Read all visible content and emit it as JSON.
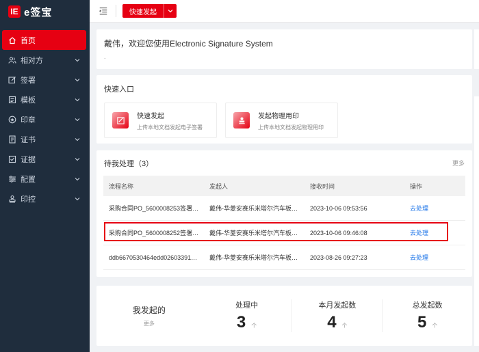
{
  "logo": {
    "mark": "IE",
    "text": "e签宝"
  },
  "sidebar": {
    "items": [
      {
        "label": "首页",
        "icon": "home-icon",
        "active": true
      },
      {
        "label": "相对方",
        "icon": "users-icon"
      },
      {
        "label": "签署",
        "icon": "edit-icon"
      },
      {
        "label": "模板",
        "icon": "template-icon"
      },
      {
        "label": "印章",
        "icon": "seal-icon"
      },
      {
        "label": "证书",
        "icon": "certificate-icon"
      },
      {
        "label": "证据",
        "icon": "evidence-icon"
      },
      {
        "label": "配置",
        "icon": "settings-icon"
      },
      {
        "label": "印控",
        "icon": "seal-control-icon"
      }
    ]
  },
  "header": {
    "quick_start_label": "快速发起"
  },
  "welcome": {
    "title": "戴伟，欢迎您使用Electronic Signature System",
    "sub": "."
  },
  "quick_entry": {
    "title": "快速入口",
    "cards": [
      {
        "title": "快速发起",
        "desc": "上传本地文档发起电子签署"
      },
      {
        "title": "发起物理用印",
        "desc": "上传本地文档发起物理用印"
      }
    ]
  },
  "pending": {
    "title": "待我处理（3）",
    "more": "更多",
    "columns": [
      "流程名称",
      "发起人",
      "接收时间",
      "操作"
    ],
    "rows": [
      {
        "name": "采购合同PO_5600008253签署…",
        "sender": "戴伟-华菱安赛乐米塔尔汽车板…",
        "time": "2023-10-06 09:53:56",
        "action": "去处理"
      },
      {
        "name": "采购合同PO_5600008252签署…",
        "sender": "戴伟-华菱安赛乐米塔尔汽车板…",
        "time": "2023-10-06 09:46:08",
        "action": "去处理"
      },
      {
        "name": "ddb6670530464edd02603391…",
        "sender": "戴伟-华菱安赛乐米塔尔汽车板…",
        "time": "2023-08-26 09:27:23",
        "action": "去处理"
      }
    ]
  },
  "stats": {
    "lead_title": "我发起的",
    "lead_sub": "更多",
    "items": [
      {
        "label": "处理中",
        "value": "3",
        "unit": "个"
      },
      {
        "label": "本月发起数",
        "value": "4",
        "unit": "个"
      },
      {
        "label": "总发起数",
        "value": "5",
        "unit": "个"
      }
    ]
  },
  "colors": {
    "brand": "#e60012",
    "sidebar_bg": "#1f2d3d",
    "link": "#1a73e8"
  }
}
